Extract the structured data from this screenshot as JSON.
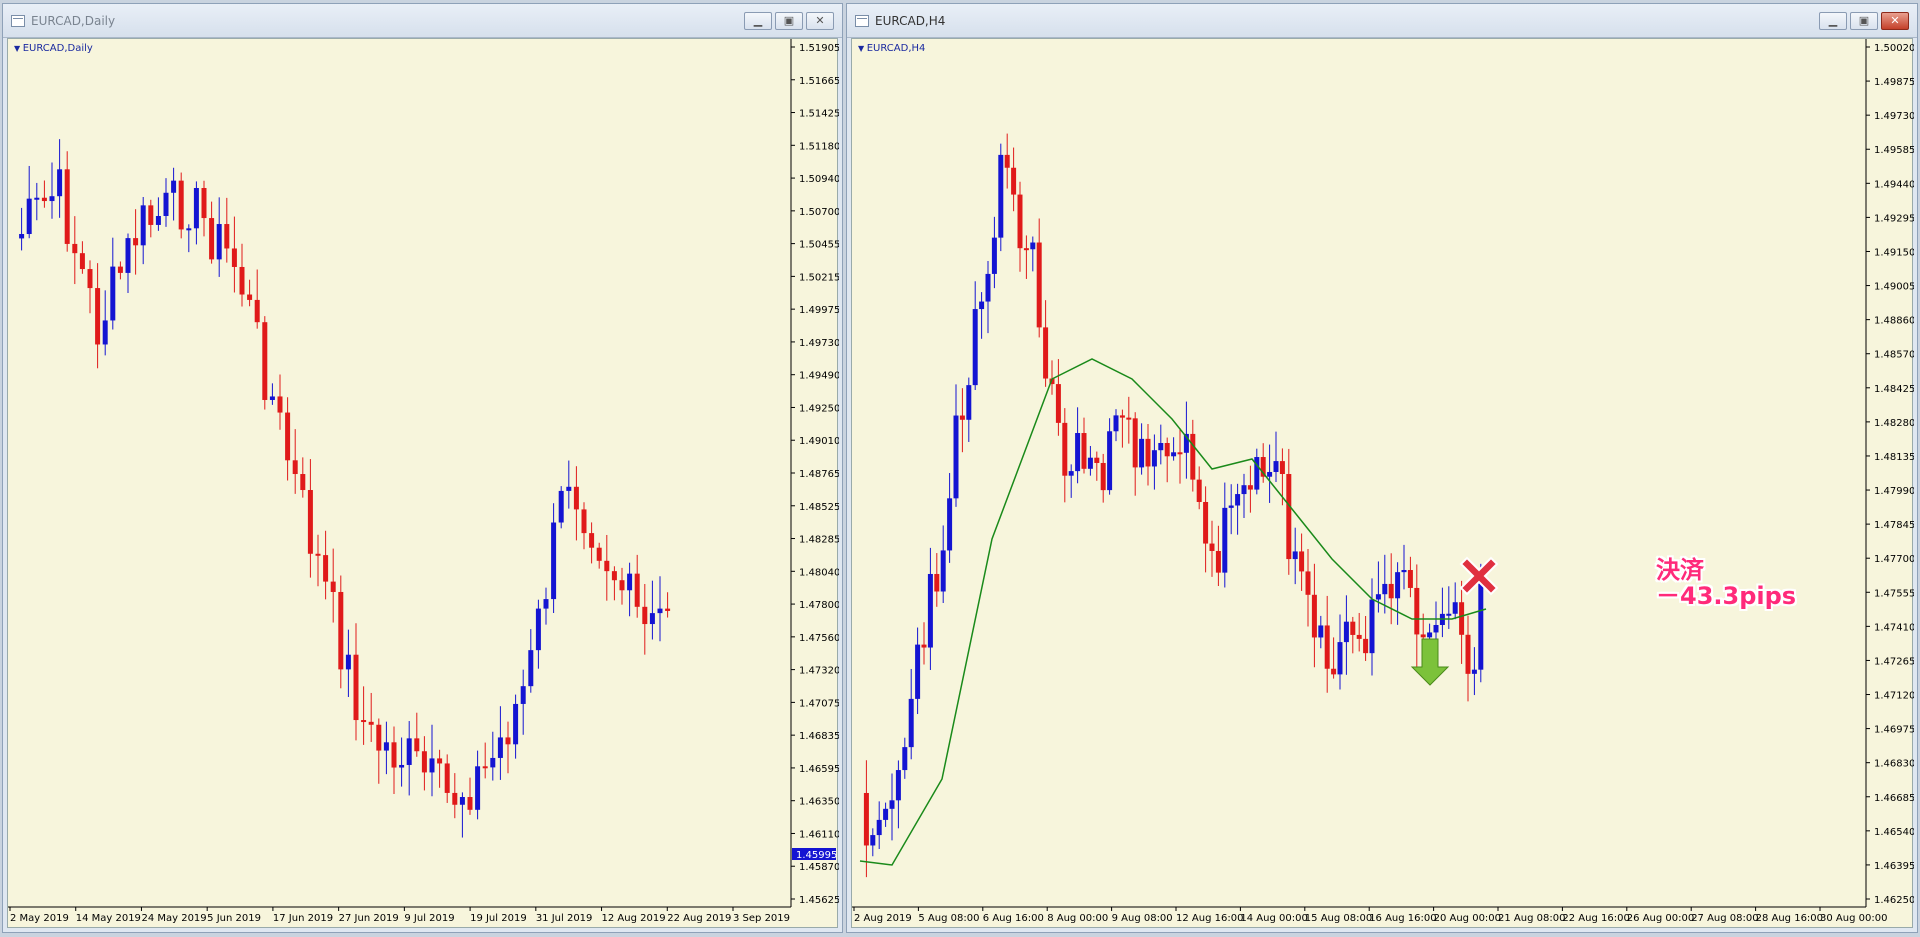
{
  "left": {
    "title": "EURCAD,Daily",
    "label": "EURCAD,Daily",
    "price_ticks": [
      "1.51905",
      "1.51665",
      "1.51425",
      "1.51180",
      "1.50940",
      "1.50700",
      "1.50455",
      "1.50215",
      "1.49975",
      "1.49730",
      "1.49490",
      "1.49250",
      "1.49010",
      "1.48765",
      "1.48525",
      "1.48285",
      "1.48040",
      "1.47800",
      "1.47560",
      "1.47320",
      "1.47075",
      "1.46835",
      "1.46595",
      "1.46350",
      "1.46110",
      "1.45870",
      "1.45625"
    ],
    "current_price": "1.45995",
    "date_ticks": [
      "2 May 2019",
      "14 May 2019",
      "24 May 2019",
      "5 Jun 2019",
      "17 Jun 2019",
      "27 Jun 2019",
      "9 Jul 2019",
      "19 Jul 2019",
      "31 Jul 2019",
      "12 Aug 2019",
      "22 Aug 2019",
      "3 Sep 2019"
    ]
  },
  "right": {
    "title": "EURCAD,H4",
    "label": "EURCAD,H4",
    "price_ticks": [
      "1.50020",
      "1.49875",
      "1.49730",
      "1.49585",
      "1.49440",
      "1.49295",
      "1.49150",
      "1.49005",
      "1.48860",
      "1.48570",
      "1.48425",
      "1.48280",
      "1.48135",
      "1.47990",
      "1.47845",
      "1.47700",
      "1.47555",
      "1.47410",
      "1.47265",
      "1.47120",
      "1.46975",
      "1.46830",
      "1.46685",
      "1.46540",
      "1.46395",
      "1.46250"
    ],
    "date_ticks": [
      "2 Aug 2019",
      "5 Aug 08:00",
      "6 Aug 16:00",
      "8 Aug 00:00",
      "9 Aug 08:00",
      "12 Aug 16:00",
      "14 Aug 00:00",
      "15 Aug 08:00",
      "16 Aug 16:00",
      "20 Aug 00:00",
      "21 Aug 08:00",
      "22 Aug 16:00",
      "26 Aug 00:00",
      "27 Aug 08:00",
      "28 Aug 16:00",
      "30 Aug 00:00"
    ],
    "annotation_line1": "決済",
    "annotation_line2": "－43.3pips",
    "ma_color": "#1a8a1a"
  },
  "colors": {
    "bull": "#1414d2",
    "bear": "#e01a1a",
    "chart_bg": "#f7f5dc"
  },
  "icons": {
    "close_mark": "red-x-icon",
    "sell_arrow": "green-down-arrow-icon"
  }
}
